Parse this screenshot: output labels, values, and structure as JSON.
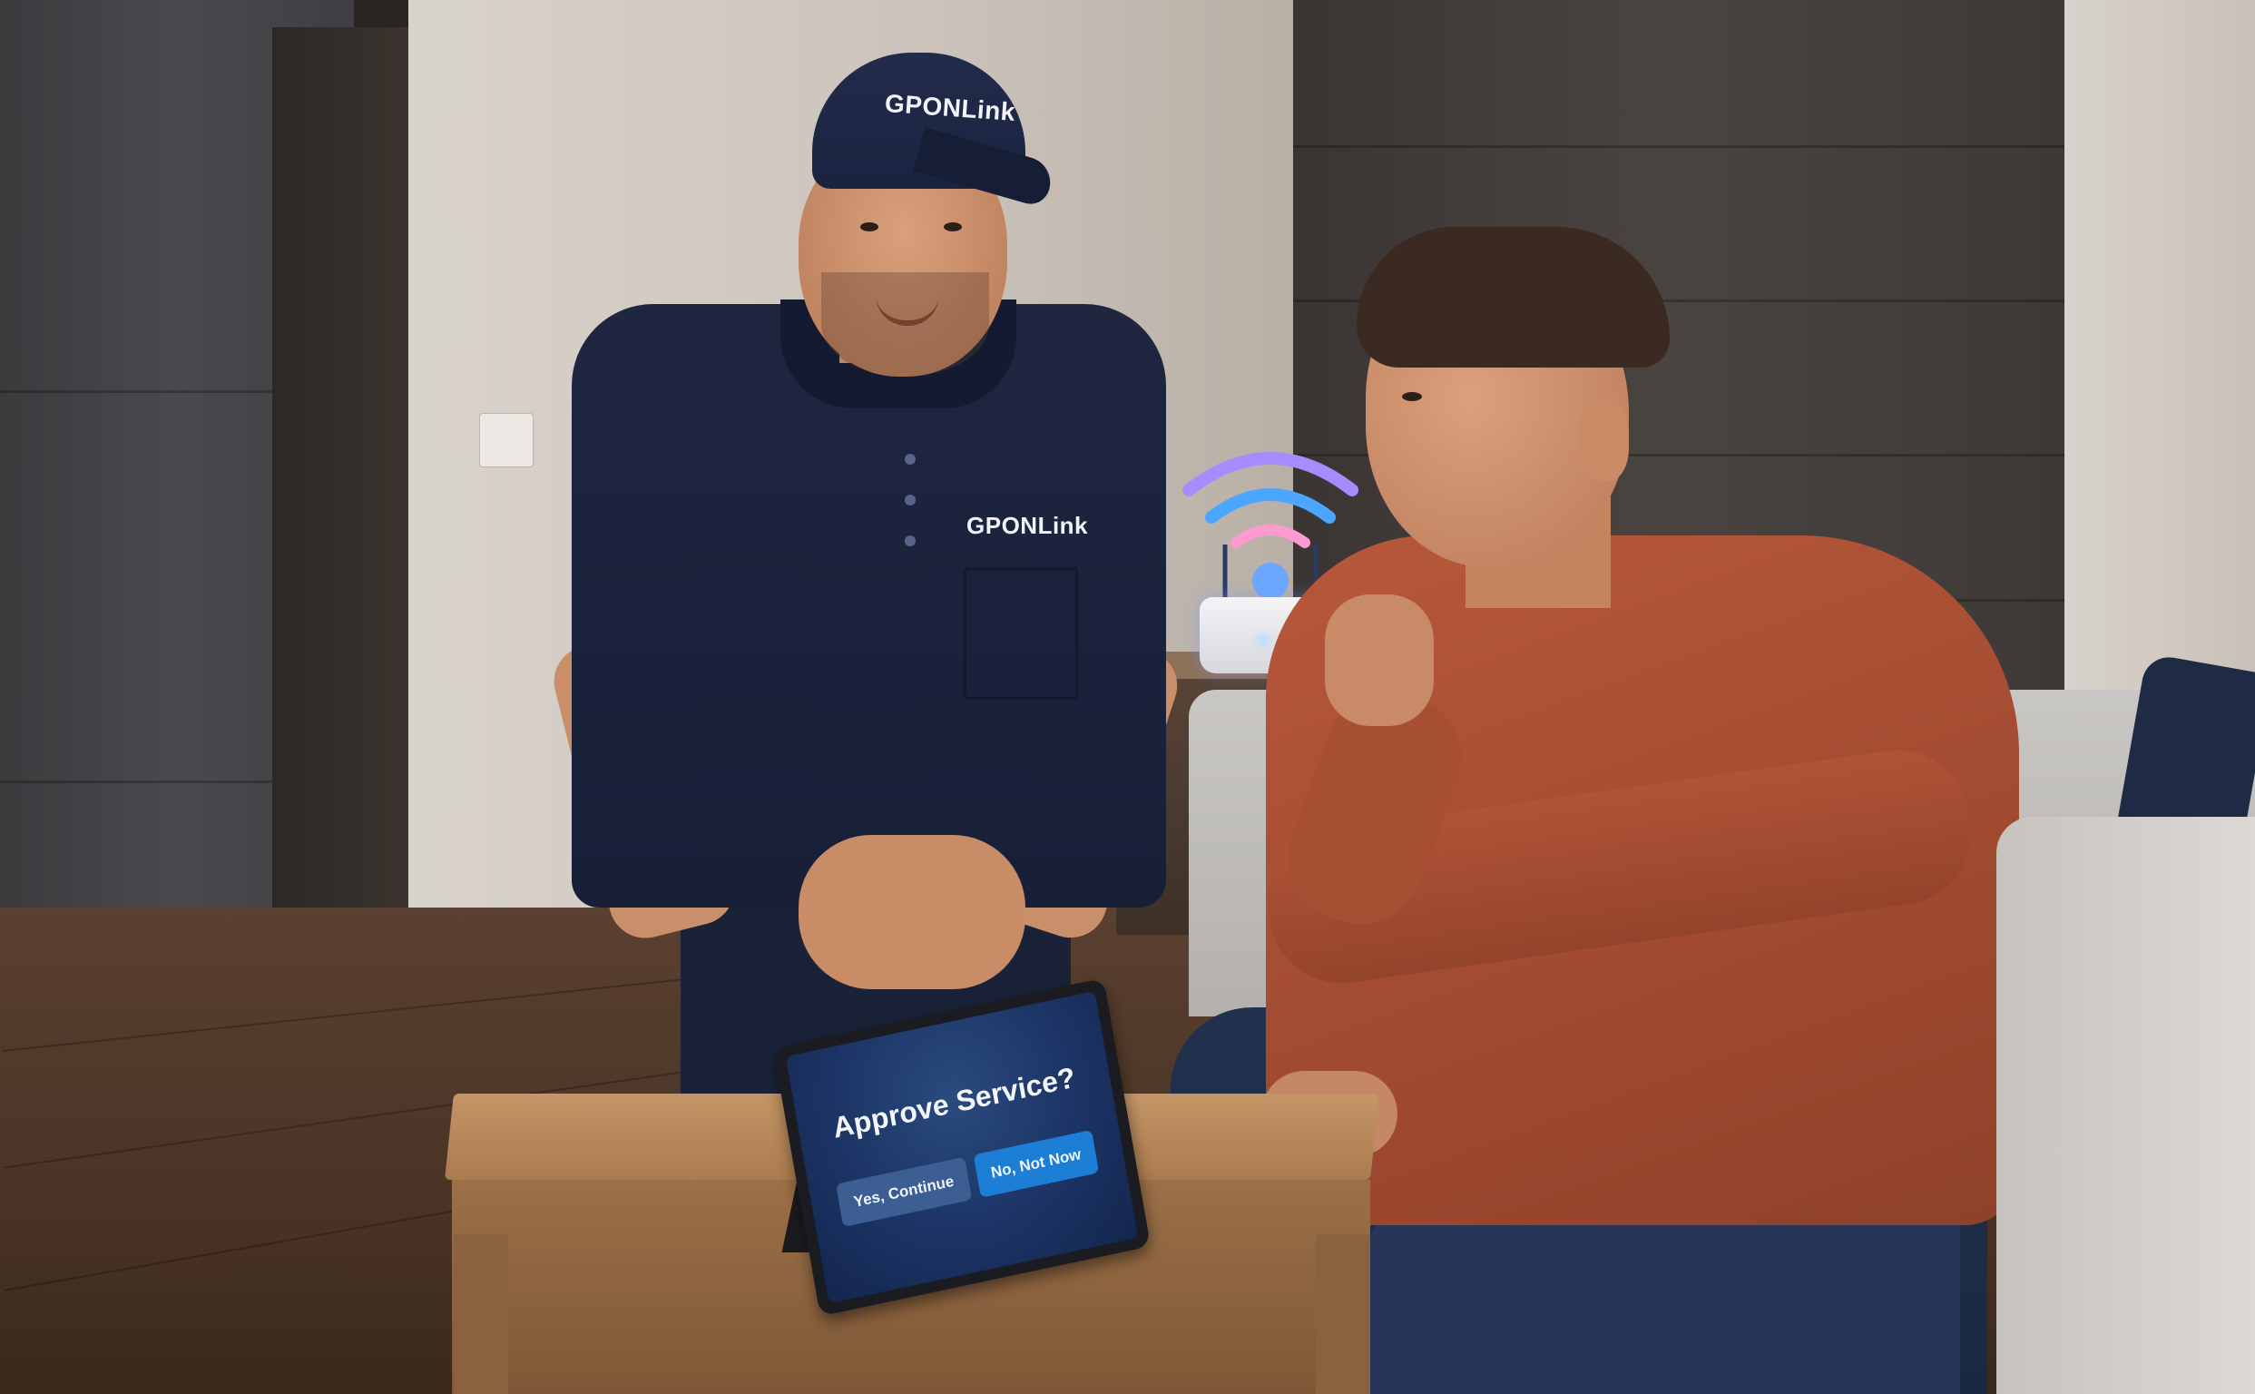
{
  "branding": {
    "cap_logo": "GPONLink",
    "shirt_logo": "GPONLink"
  },
  "tablet": {
    "dialog_title": "Approve Service?",
    "yes_label": "Yes, Continue",
    "no_label": "No, Not Now"
  },
  "colors": {
    "uniform_navy": "#1e2640",
    "sweater_rust": "#a04a30",
    "wifi_purple": "#a58cff",
    "wifi_blue": "#4aa6ff",
    "wifi_pink": "#ff9ad0",
    "tablet_screen": "#1b3263",
    "primary_button": "#1d7ed6",
    "secondary_button": "#3d5e93"
  },
  "icons": [
    "wifi-signal-icon"
  ]
}
